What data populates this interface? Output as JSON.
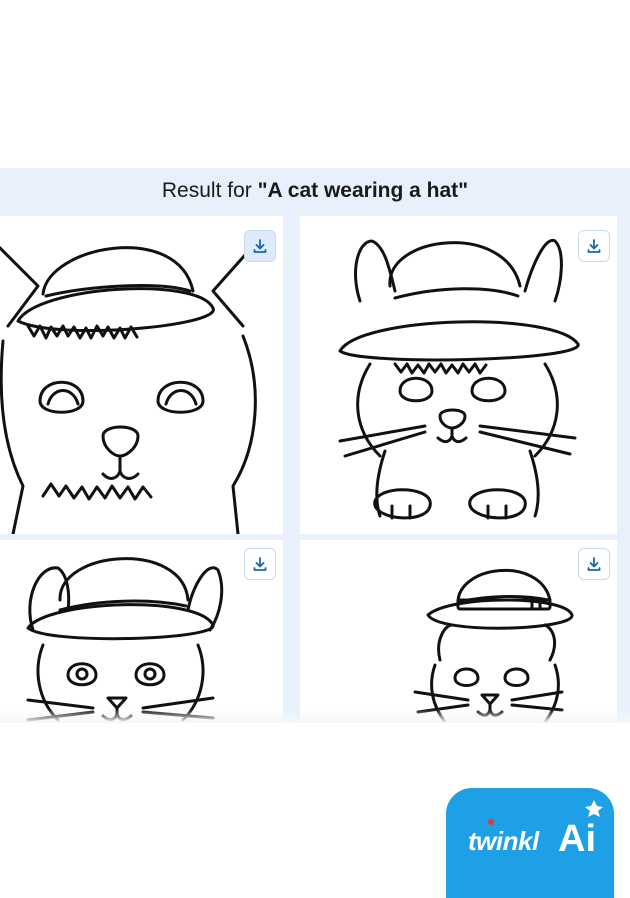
{
  "results": {
    "prefix": "Result for ",
    "query": "\"A cat wearing a hat\""
  },
  "images": [
    {
      "name": "cat-image-1",
      "download_icon": "download-icon"
    },
    {
      "name": "cat-image-2",
      "download_icon": "download-icon"
    },
    {
      "name": "cat-image-3",
      "download_icon": "download-icon"
    },
    {
      "name": "cat-image-4",
      "download_icon": "download-icon"
    }
  ],
  "brand": {
    "logo_text": "twinkl",
    "ai_text": "Ai",
    "color": "#1ea0e6"
  },
  "colors": {
    "panel_background": "#e8f1fb",
    "card_background": "#ffffff",
    "line_art": "#111111"
  }
}
